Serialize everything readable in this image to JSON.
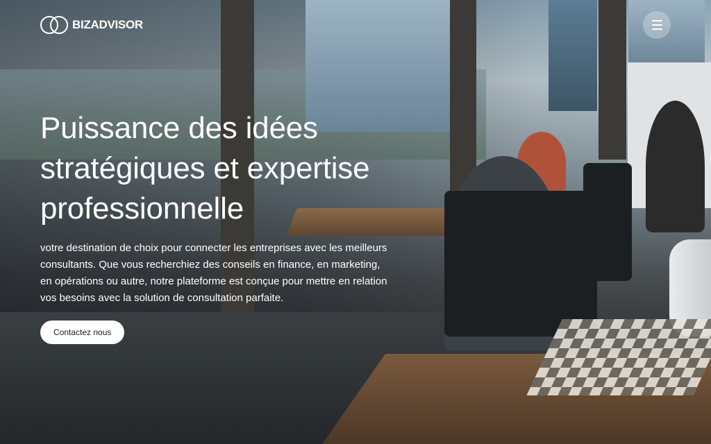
{
  "header": {
    "logo_text": "BIZADVISOR",
    "menu_icon": "hamburger-menu-icon"
  },
  "hero": {
    "title_lines": [
      "Puissance des idées",
      "stratégiques et expertise",
      "professionnelle"
    ],
    "description": "votre destination de choix pour connecter les entreprises avec les meilleurs consultants. Que vous recherchiez des conseils en finance, en marketing, en opérations ou autre, notre plateforme est conçue pour mettre en relation vos besoins avec la solution de consultation parfaite.",
    "cta_label": "Contactez nous"
  },
  "colors": {
    "text": "#ffffff",
    "button_bg": "#ffffff",
    "button_text": "#1b1b1b"
  }
}
